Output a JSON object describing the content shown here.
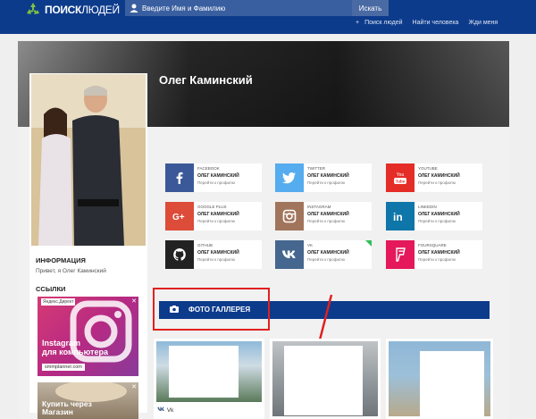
{
  "header": {
    "logo_bold": "ПОИСК",
    "logo_thin": "ЛЮДЕЙ",
    "search_placeholder": "Введите Имя и Фамилию",
    "search_button": "Искать",
    "nav": [
      "Поиск людей",
      "Найти человека",
      "Жди меня"
    ],
    "plus": "+"
  },
  "profile": {
    "name": "Олег Каминский",
    "info_title": "ИНФОРМАЦИЯ",
    "info_text": "Привет, я Олег Каминский",
    "links_title": "ССЫЛКИ"
  },
  "socials": [
    {
      "network": "FACEBOOK",
      "user": "ОЛЕГ КАМИНСКИЙ",
      "go": "Перейти к профилю",
      "color": "#3b5998",
      "icon": "facebook-icon"
    },
    {
      "network": "TWITTER",
      "user": "ОЛЕГ КАМИНСКИЙ",
      "go": "Перейти к профилю",
      "color": "#55acee",
      "icon": "twitter-icon"
    },
    {
      "network": "YOUTUBE",
      "user": "ОЛЕГ КАМИНСКИЙ",
      "go": "Перейти к профилю",
      "color": "#e52d27",
      "icon": "youtube-icon"
    },
    {
      "network": "GOOGLE PLUS",
      "user": "ОЛЕГ КАМИНСКИЙ",
      "go": "Перейти к профилю",
      "color": "#dd4b39",
      "icon": "google-plus-icon"
    },
    {
      "network": "INSTAGRAM",
      "user": "ОЛЕГ КАМИНСКИЙ",
      "go": "Перейти к профилю",
      "color": "#a1755c",
      "icon": "instagram-icon"
    },
    {
      "network": "LINKEDIN",
      "user": "ОЛЕГ КАМИНСКИЙ",
      "go": "Перейти к профилю",
      "color": "#0e76a8",
      "icon": "linkedin-icon"
    },
    {
      "network": "GITHUB",
      "user": "ОЛЕГ КАМИНСКИЙ",
      "go": "Перейти к профилю",
      "color": "#222222",
      "icon": "github-icon"
    },
    {
      "network": "VK",
      "user": "ОЛЕГ КАМИНСКИЙ",
      "go": "Перейти к профилю",
      "color": "#45668e",
      "icon": "vk-icon"
    },
    {
      "network": "FOURSQUARE",
      "user": "ОЛЕГ КАМИНСКИЙ",
      "go": "Перейти к профилю",
      "color": "#e4185b",
      "icon": "foursquare-icon"
    }
  ],
  "gallery": {
    "title": "ФОТО ГАЛЛЕРЕЯ",
    "photos": [
      {
        "caption": "Vk",
        "icon": "vk-icon"
      }
    ]
  },
  "ads": {
    "ad1_badge": "Яндекс.Директ",
    "ad1_title_line1": "Instagram",
    "ad1_title_line2": "для компьютера",
    "ad1_link": "smmplanner.com",
    "ad2_title_line1": "Купить через",
    "ad2_title_line2": "Магазин"
  },
  "colors": {
    "header": "#0d3b8c",
    "highlight": "#e02020"
  }
}
